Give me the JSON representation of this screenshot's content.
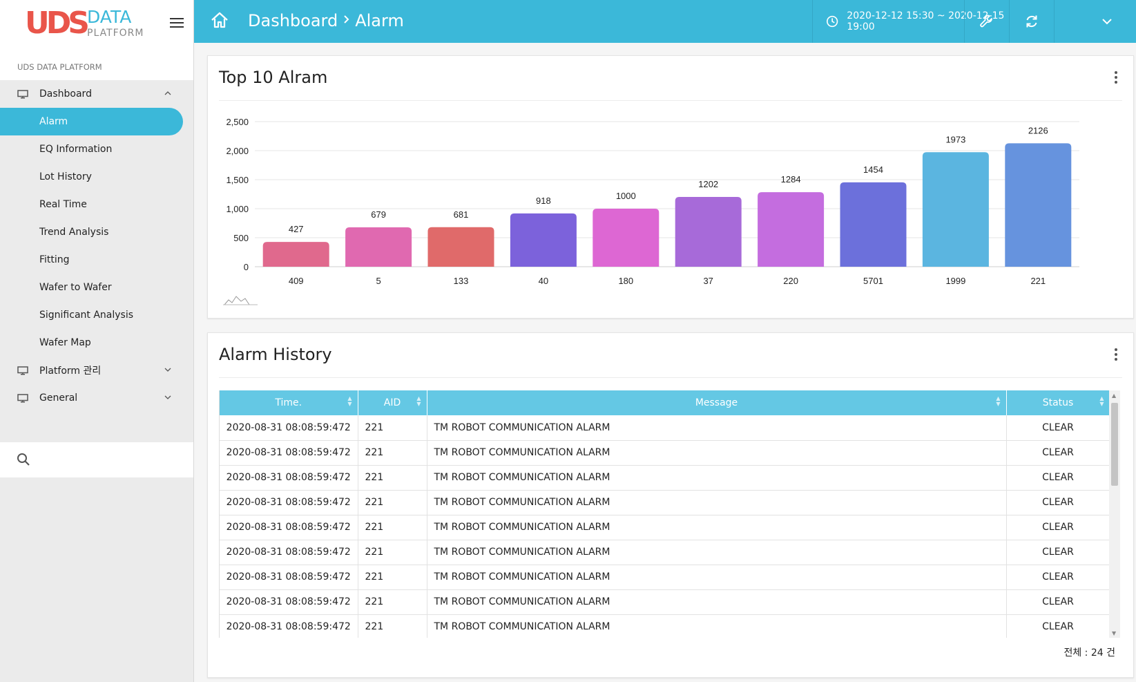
{
  "logo": {
    "uds": "UDS",
    "data": "DATA",
    "platform": "PLATFORM"
  },
  "sidebar": {
    "section_label": "UDS DATA PLATFORM",
    "groups": [
      {
        "label": "Dashboard",
        "icon": "monitor-icon",
        "expanded": true
      },
      {
        "label": "Platform 관리",
        "icon": "monitor-icon",
        "expanded": false
      },
      {
        "label": "General",
        "icon": "monitor-icon",
        "expanded": false
      }
    ],
    "dashboard_items": [
      "Alarm",
      "EQ Information",
      "Lot History",
      "Real Time",
      "Trend Analysis",
      "Fitting",
      "Wafer to Wafer",
      "Significant Analysis",
      "Wafer Map"
    ],
    "active_item": "Alarm",
    "search_placeholder": ""
  },
  "header": {
    "breadcrumb": [
      "Dashboard",
      "Alarm"
    ],
    "time_range": "2020-12-12 15:30 ~ 2020-12-15 19:00",
    "icons": [
      "home-icon",
      "clock-icon",
      "wrench-icon",
      "refresh-icon",
      "chevron-down-icon"
    ]
  },
  "chart_card": {
    "title": "Top 10 Alram"
  },
  "chart_data": {
    "type": "bar",
    "title": "Top 10 Alram",
    "categories": [
      "409",
      "5",
      "133",
      "40",
      "180",
      "37",
      "220",
      "5701",
      "1999",
      "221"
    ],
    "values": [
      427,
      679,
      681,
      918,
      1000,
      1202,
      1284,
      1454,
      1973,
      2126
    ],
    "colors": [
      "#e0698d",
      "#e069b0",
      "#e06a6a",
      "#7c62db",
      "#dd67d3",
      "#a76ad9",
      "#c46ddf",
      "#6c70db",
      "#5bb5e0",
      "#6693de"
    ],
    "ylim": [
      0,
      2500
    ],
    "yticks": [
      0,
      500,
      1000,
      1500,
      2000,
      2500
    ],
    "ytick_labels": [
      "0",
      "500",
      "1,000",
      "1,500",
      "2,000",
      "2,500"
    ],
    "grid": true,
    "data_labels": true,
    "xlabel": "",
    "ylabel": ""
  },
  "table_card": {
    "title": "Alarm History",
    "columns": [
      "Time.",
      "AID",
      "Message",
      "Status"
    ],
    "rows": [
      [
        "2020-08-31 08:08:59:472",
        "221",
        "TM ROBOT COMMUNICATION ALARM",
        "CLEAR"
      ],
      [
        "2020-08-31 08:08:59:472",
        "221",
        "TM ROBOT COMMUNICATION ALARM",
        "CLEAR"
      ],
      [
        "2020-08-31 08:08:59:472",
        "221",
        "TM ROBOT COMMUNICATION ALARM",
        "CLEAR"
      ],
      [
        "2020-08-31 08:08:59:472",
        "221",
        "TM ROBOT COMMUNICATION ALARM",
        "CLEAR"
      ],
      [
        "2020-08-31 08:08:59:472",
        "221",
        "TM ROBOT COMMUNICATION ALARM",
        "CLEAR"
      ],
      [
        "2020-08-31 08:08:59:472",
        "221",
        "TM ROBOT COMMUNICATION ALARM",
        "CLEAR"
      ],
      [
        "2020-08-31 08:08:59:472",
        "221",
        "TM ROBOT COMMUNICATION ALARM",
        "CLEAR"
      ],
      [
        "2020-08-31 08:08:59:472",
        "221",
        "TM ROBOT COMMUNICATION ALARM",
        "CLEAR"
      ],
      [
        "2020-08-31 08:08:59:472",
        "221",
        "TM ROBOT COMMUNICATION ALARM",
        "CLEAR"
      ]
    ],
    "total": "전체 : 24 건"
  },
  "colors": {
    "accent": "#3bb8d9",
    "table_header": "#64c8e4"
  }
}
